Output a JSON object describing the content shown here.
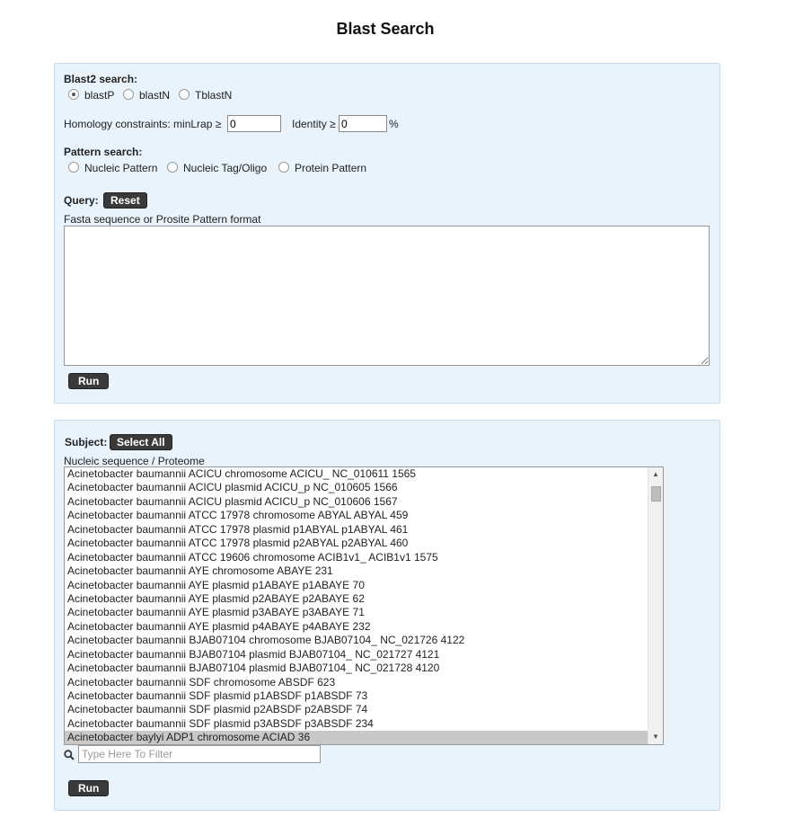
{
  "title": "Blast Search",
  "blast": {
    "label": "Blast2 search:",
    "options": [
      {
        "label": "blastP",
        "checked": true
      },
      {
        "label": "blastN",
        "checked": false
      },
      {
        "label": "TblastN",
        "checked": false
      }
    ],
    "homology_label": "Homology constraints: minLrap ≥",
    "minlrap_value": "0",
    "identity_label": "Identity ≥",
    "identity_value": "0",
    "percent": "%"
  },
  "pattern": {
    "label": "Pattern search:",
    "options": [
      {
        "label": "Nucleic Pattern",
        "checked": false
      },
      {
        "label": "Nucleic Tag/Oligo",
        "checked": false
      },
      {
        "label": "Protein Pattern",
        "checked": false
      }
    ]
  },
  "query": {
    "label": "Query:",
    "reset_label": "Reset",
    "hint": "Fasta sequence or Prosite Pattern format",
    "value": "",
    "run_label": "Run"
  },
  "subject": {
    "label": "Subject:",
    "select_all_label": "Select All",
    "hint": "Nucleic sequence / Proteome",
    "items": [
      "Acinetobacter baumannii ACICU chromosome ACICU_ NC_010611 1565",
      "Acinetobacter baumannii ACICU plasmid ACICU_p NC_010605 1566",
      "Acinetobacter baumannii ACICU plasmid ACICU_p NC_010606 1567",
      "Acinetobacter baumannii ATCC 17978 chromosome ABYAL ABYAL 459",
      "Acinetobacter baumannii ATCC 17978 plasmid p1ABYAL p1ABYAL 461",
      "Acinetobacter baumannii ATCC 17978 plasmid p2ABYAL p2ABYAL 460",
      "Acinetobacter baumannii ATCC 19606 chromosome ACIB1v1_ ACIB1v1 1575",
      "Acinetobacter baumannii AYE chromosome ABAYE 231",
      "Acinetobacter baumannii AYE plasmid p1ABAYE p1ABAYE 70",
      "Acinetobacter baumannii AYE plasmid p2ABAYE p2ABAYE 62",
      "Acinetobacter baumannii AYE plasmid p3ABAYE p3ABAYE 71",
      "Acinetobacter baumannii AYE plasmid p4ABAYE p4ABAYE 232",
      "Acinetobacter baumannii BJAB07104 chromosome BJAB07104_ NC_021726 4122",
      "Acinetobacter baumannii BJAB07104 plasmid BJAB07104_ NC_021727 4121",
      "Acinetobacter baumannii BJAB07104 plasmid BJAB07104_ NC_021728 4120",
      "Acinetobacter baumannii SDF chromosome ABSDF 623",
      "Acinetobacter baumannii SDF plasmid p1ABSDF p1ABSDF 73",
      "Acinetobacter baumannii SDF plasmid p2ABSDF p2ABSDF 74",
      "Acinetobacter baumannii SDF plasmid p3ABSDF p3ABSDF 234",
      "Acinetobacter baylyi ADP1 chromosome ACIAD 36"
    ],
    "selected_index": 19,
    "filter_icon": "search-icon",
    "filter_placeholder": "Type Here To Filter",
    "run_label": "Run"
  }
}
